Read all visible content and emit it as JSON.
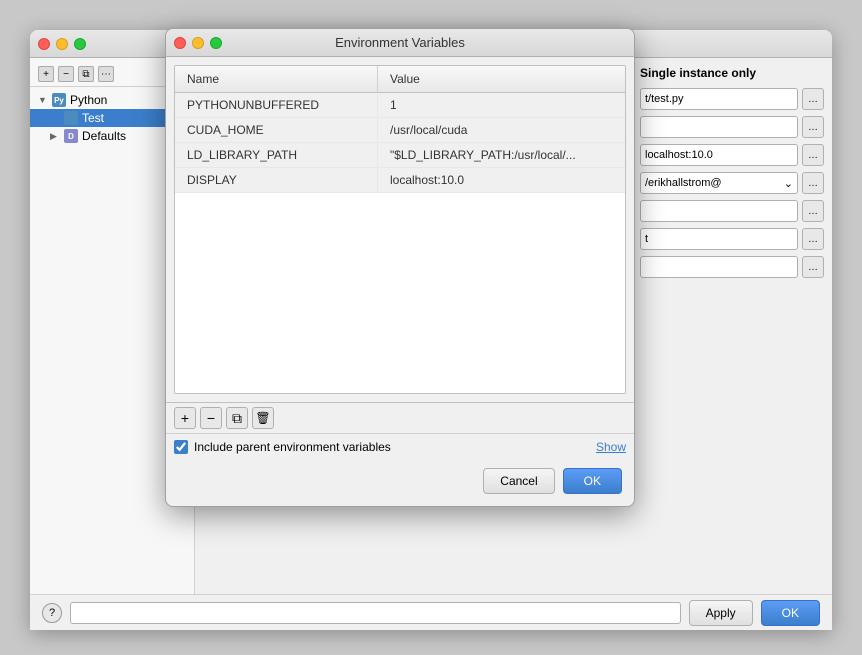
{
  "ide": {
    "sidebar": {
      "toolbar": {
        "add_label": "+",
        "remove_label": "−",
        "copy_label": "⧉",
        "more_label": "⋯"
      },
      "items": [
        {
          "label": "Python",
          "type": "group",
          "expanded": true
        },
        {
          "label": "Test",
          "type": "file",
          "selected": true
        },
        {
          "label": "Defaults",
          "type": "defaults"
        }
      ]
    },
    "right_panel": {
      "title": "Single instance only",
      "script_path_value": "t/test.py",
      "display_value": "localhost:10.0",
      "user_value": "/erikhallstrom@",
      "field4_value": "t",
      "ellipsis": "..."
    },
    "bottom": {
      "help_label": "?",
      "apply_label": "Apply",
      "ok_label": "OK"
    }
  },
  "dialog": {
    "title": "Environment Variables",
    "traffic_lights": {
      "close": "close",
      "min": "minimize",
      "max": "maximize"
    },
    "table": {
      "headers": [
        {
          "id": "name",
          "label": "Name"
        },
        {
          "id": "value",
          "label": "Value"
        }
      ],
      "rows": [
        {
          "name": "PYTHONUNBUFFERED",
          "value": "1"
        },
        {
          "name": "CUDA_HOME",
          "value": "/usr/local/cuda"
        },
        {
          "name": "LD_LIBRARY_PATH",
          "value": "\"$LD_LIBRARY_PATH:/usr/local/..."
        },
        {
          "name": "DISPLAY",
          "value": "localhost:10.0"
        }
      ]
    },
    "toolbar": {
      "add_label": "+",
      "remove_label": "−",
      "copy_label": "⧉",
      "delete_label": "🗑"
    },
    "footer": {
      "checkbox_label": "Include parent environment variables",
      "show_label": "Show"
    },
    "buttons": {
      "cancel_label": "Cancel",
      "ok_label": "OK"
    }
  }
}
